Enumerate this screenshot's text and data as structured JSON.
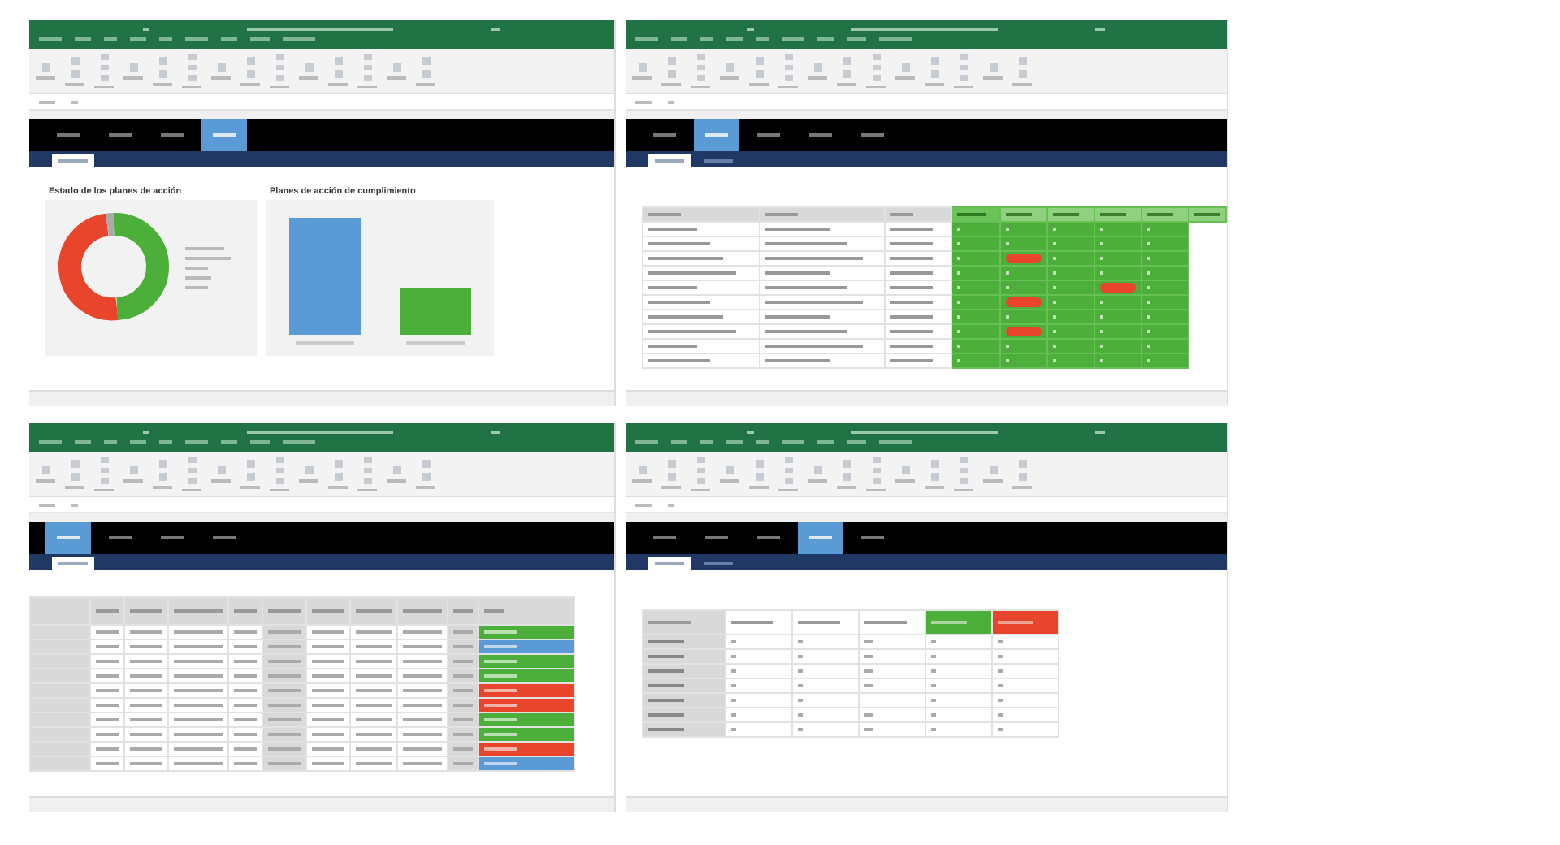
{
  "windows": [
    {
      "kind": "charts",
      "nav_tabs": [
        {
          "selected": false
        },
        {
          "selected": false
        },
        {
          "selected": false
        },
        {
          "selected": true
        }
      ],
      "sub_tabs": [
        {
          "selected": true
        }
      ],
      "charts": [
        {
          "title": "Estado de los planes de acción"
        },
        {
          "title": "Planes de acción de cumplimiento"
        }
      ]
    },
    {
      "kind": "matrix",
      "nav_tabs": [
        {
          "selected": false
        },
        {
          "selected": true
        },
        {
          "selected": false
        },
        {
          "selected": false
        },
        {
          "selected": false
        }
      ],
      "sub_tabs": [
        {
          "selected": true
        },
        {
          "selected": false
        }
      ],
      "rows": [
        {
          "alerts": [
            false,
            false,
            false,
            false,
            false
          ]
        },
        {
          "alerts": [
            false,
            false,
            false,
            false,
            false
          ]
        },
        {
          "alerts": [
            false,
            true,
            false,
            false,
            false
          ]
        },
        {
          "alerts": [
            false,
            false,
            false,
            false,
            false
          ]
        },
        {
          "alerts": [
            false,
            false,
            false,
            true,
            false
          ]
        },
        {
          "alerts": [
            false,
            true,
            false,
            false,
            false
          ]
        },
        {
          "alerts": [
            false,
            false,
            false,
            false,
            false
          ]
        },
        {
          "alerts": [
            false,
            true,
            false,
            false,
            false
          ]
        },
        {
          "alerts": [
            false,
            false,
            false,
            false,
            false
          ]
        },
        {
          "alerts": [
            false,
            false,
            false,
            false,
            false
          ]
        }
      ]
    },
    {
      "kind": "table",
      "nav_tabs": [
        {
          "selected": true
        },
        {
          "selected": false
        },
        {
          "selected": false
        },
        {
          "selected": false
        }
      ],
      "sub_tabs": [
        {
          "selected": true
        }
      ],
      "rows": [
        {
          "color": "#4caf3a"
        },
        {
          "color": "#5b9bd5"
        },
        {
          "color": "#4caf3a"
        },
        {
          "color": "#4caf3a"
        },
        {
          "color": "#e8452c"
        },
        {
          "color": "#e8452c"
        },
        {
          "color": "#4caf3a"
        },
        {
          "color": "#4caf3a"
        },
        {
          "color": "#e8452c"
        },
        {
          "color": "#5b9bd5"
        }
      ]
    },
    {
      "kind": "summary",
      "nav_tabs": [
        {
          "selected": false
        },
        {
          "selected": false
        },
        {
          "selected": false
        },
        {
          "selected": true
        },
        {
          "selected": false
        }
      ],
      "sub_tabs": [
        {
          "selected": true
        },
        {
          "selected": false
        }
      ],
      "status_columns": [
        {
          "color": "#4caf3a"
        },
        {
          "color": "#e8452c"
        }
      ]
    }
  ]
}
